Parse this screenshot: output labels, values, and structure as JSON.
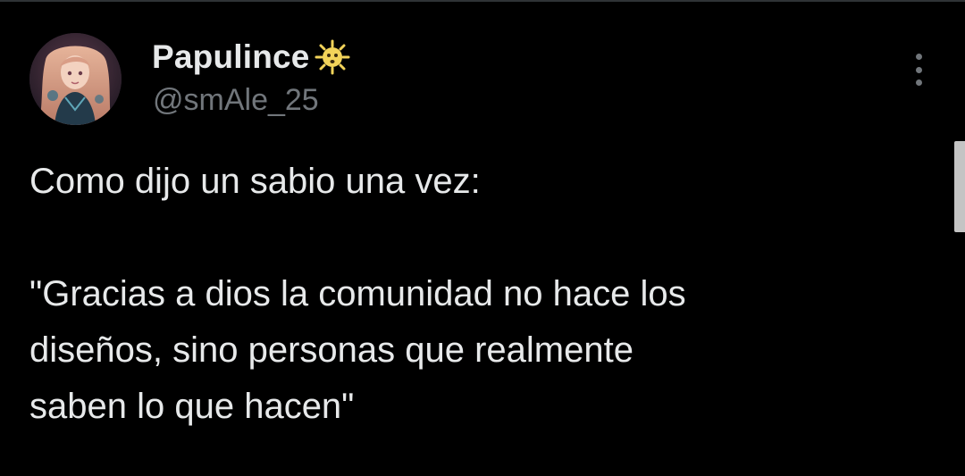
{
  "post": {
    "author": {
      "display_name": "Papulince",
      "name_emoji": "dizzy-sun-face-emoji",
      "handle": "@smAle_25",
      "avatar": "anime-portrait-avatar"
    },
    "text": "Como dijo un sabio una vez:\n\n\"Gracias a dios la comunidad no hace los\ndiseños, sino personas que realmente\nsaben lo que hacen\"",
    "more_icon": "more-vertical-icon"
  },
  "colors": {
    "background": "#000000",
    "primary_text": "#e7e9ea",
    "secondary_text": "#71767b",
    "scrollbar": "#c4c4c4"
  }
}
